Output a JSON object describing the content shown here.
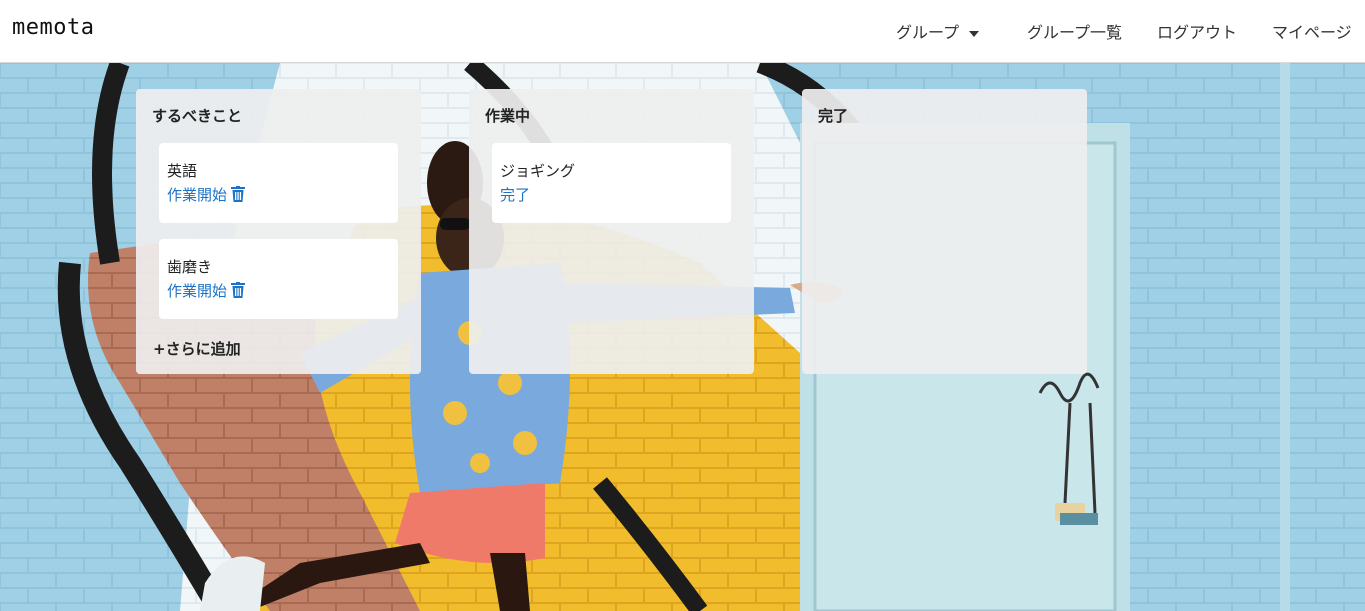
{
  "navbar": {
    "brand": "memota",
    "group_dropdown": "グループ",
    "group_list": "グループ一覧",
    "logout": "ログアウト",
    "mypage": "マイページ"
  },
  "board": {
    "columns": [
      {
        "title": "するべきこと",
        "cards": [
          {
            "title": "英語",
            "action": "作業開始"
          },
          {
            "title": "歯磨き",
            "action": "作業開始"
          }
        ],
        "add_more": "+さらに追加"
      },
      {
        "title": "作業中",
        "cards": [
          {
            "title": "ジョギング",
            "action": "完了"
          }
        ]
      },
      {
        "title": "完了",
        "cards": []
      }
    ]
  },
  "icons": {
    "trash": "trash-icon",
    "caret": "caret-down-icon"
  },
  "colors": {
    "link": "#1a73c8",
    "navbar_bg": "#ffffff",
    "column_bg": "#eeeeee"
  }
}
